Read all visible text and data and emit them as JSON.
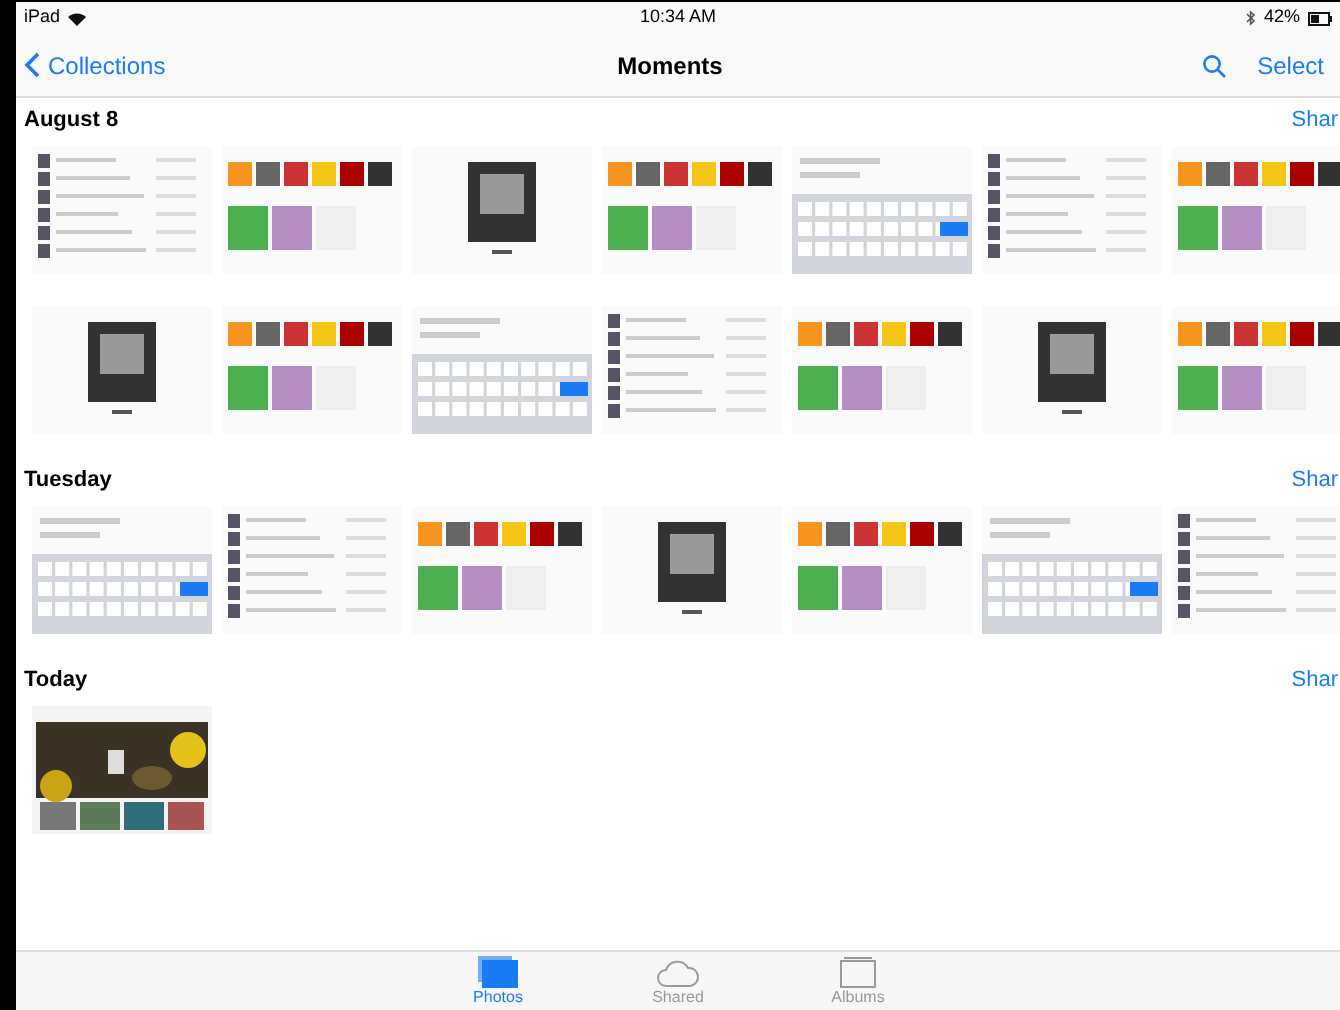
{
  "status_bar": {
    "carrier": "iPad",
    "time": "10:34 AM",
    "battery": "42%"
  },
  "nav_bar": {
    "back": "Collections",
    "title": "Moments",
    "select": "Select"
  },
  "sections": [
    {
      "title": "August 8",
      "action": "Shar"
    },
    {
      "title": "Tuesday",
      "action": "Shar"
    },
    {
      "title": "Today",
      "action": "Shar"
    }
  ],
  "tab_bar": [
    {
      "label": "Photos",
      "selected": true
    },
    {
      "label": "Shared",
      "selected": false
    },
    {
      "label": "Albums",
      "selected": false
    }
  ]
}
